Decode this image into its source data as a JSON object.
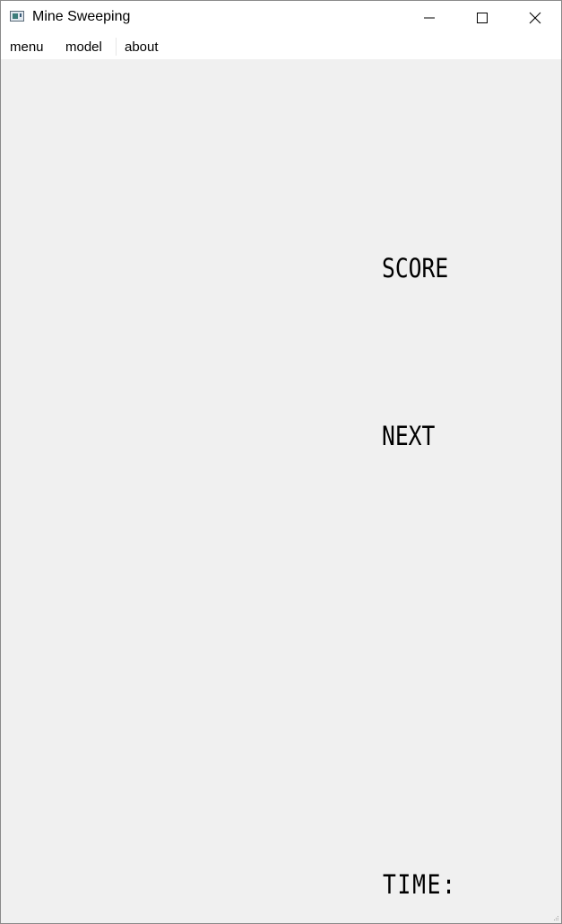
{
  "window": {
    "title": "Mine Sweeping",
    "controls": {
      "minimize": "minimize-icon",
      "maximize": "maximize-icon",
      "close": "close-icon"
    }
  },
  "menubar": {
    "items": [
      {
        "label": "menu"
      },
      {
        "label": "model"
      },
      {
        "label": "about"
      }
    ]
  },
  "game": {
    "score_label": "SCORE",
    "next_label": "NEXT",
    "time_label": "TIME:"
  },
  "colors": {
    "client_background": "#f0f0f0",
    "chrome_background": "#ffffff",
    "text": "#000000"
  }
}
